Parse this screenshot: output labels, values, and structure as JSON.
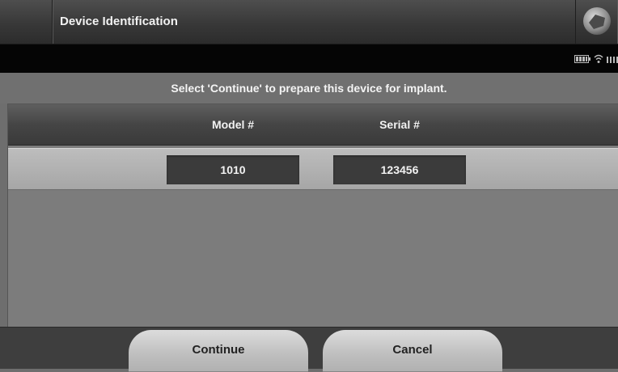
{
  "header": {
    "title": "Device Identification"
  },
  "status": {
    "icons": [
      "battery-icon",
      "wifi-icon",
      "signal-icon"
    ]
  },
  "prompt": "Select 'Continue' to prepare this device for implant.",
  "table": {
    "columns": [
      "Model #",
      "Serial #"
    ],
    "rows": [
      {
        "model": "1010",
        "serial": "123456"
      }
    ]
  },
  "buttons": {
    "continue": "Continue",
    "cancel": "Cancel"
  }
}
